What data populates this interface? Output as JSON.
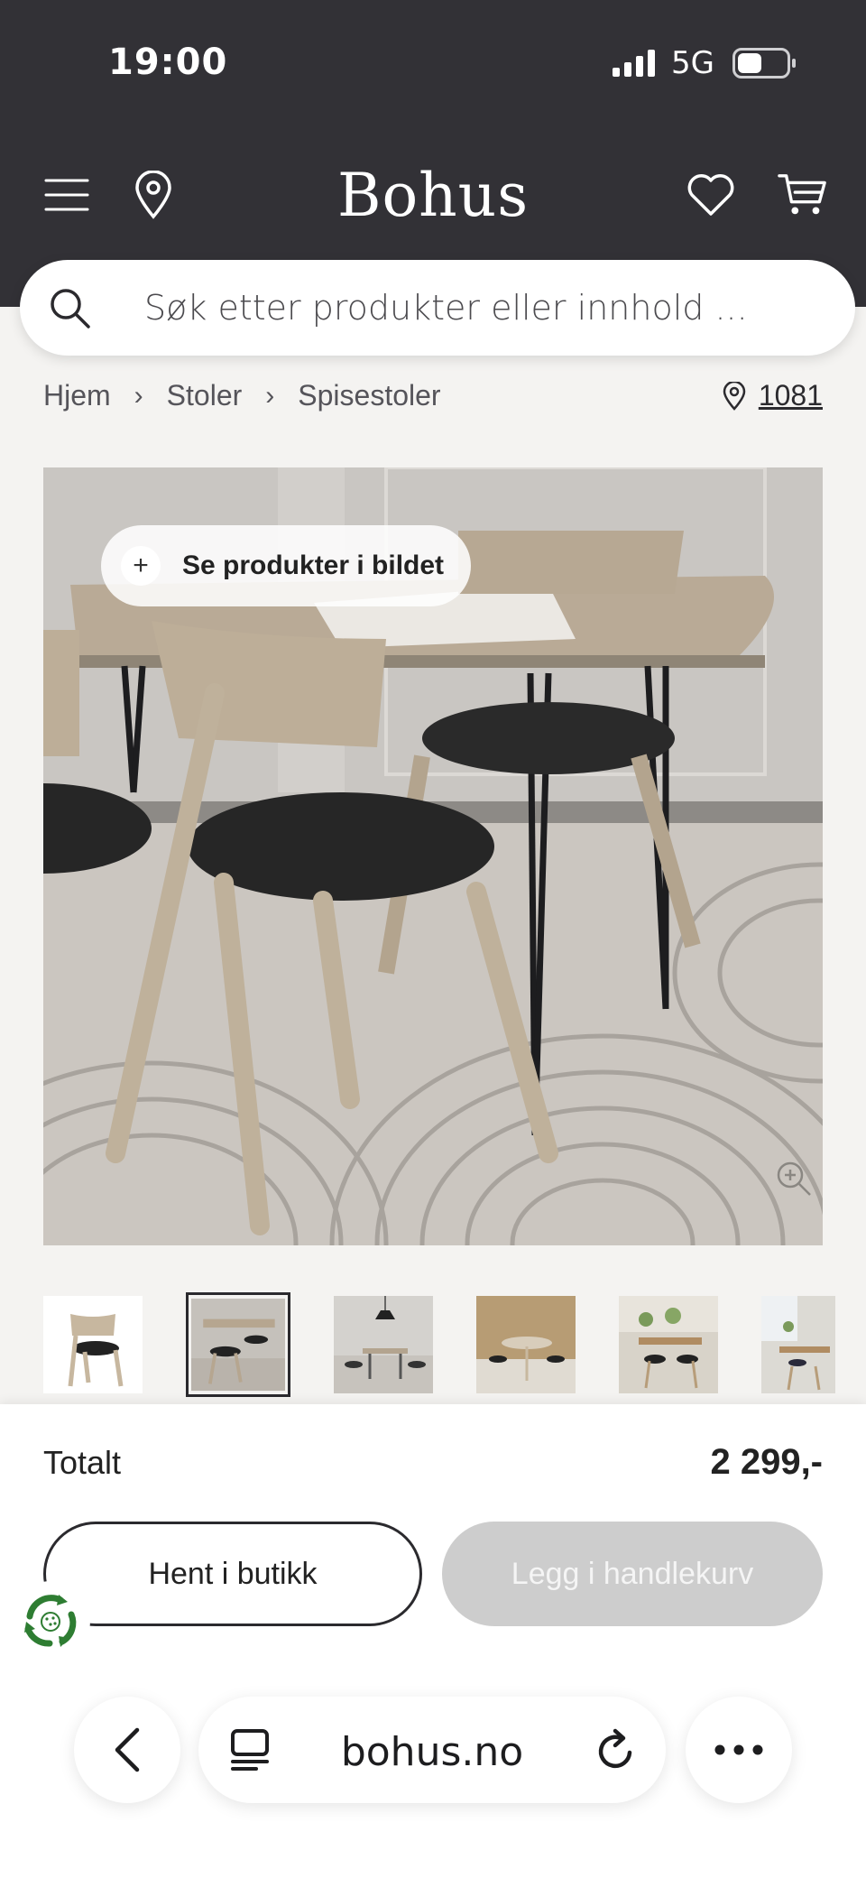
{
  "status": {
    "time": "19:00",
    "network": "5G"
  },
  "header": {
    "brand": "Bohus"
  },
  "search": {
    "placeholder": "Søk etter produkter eller innhold ..."
  },
  "breadcrumb": {
    "items": [
      "Hjem",
      "Stoler",
      "Spisestoler"
    ],
    "store_number": "1081"
  },
  "hero": {
    "pill_label": "Se produkter i bildet"
  },
  "purchase": {
    "total_label": "Totalt",
    "total_price": "2 299,-",
    "pickup_label": "Hent i butikk",
    "add_to_cart_label": "Legg i handlekurv"
  },
  "browser": {
    "url": "bohus.no"
  },
  "colors": {
    "header_bg": "#323136",
    "page_bg": "#f4f3f1",
    "disabled_button": "#cdcdcd",
    "eco_green": "#2e7d32"
  }
}
